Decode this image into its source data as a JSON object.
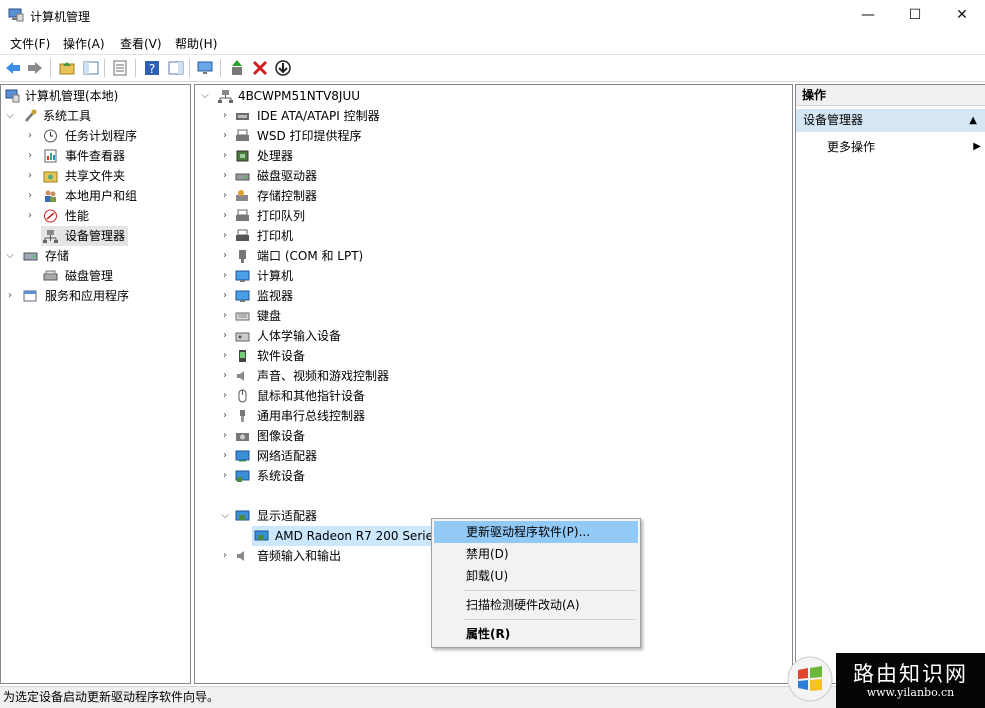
{
  "window": {
    "title": "计算机管理",
    "minimize": "—",
    "maximize": "☐",
    "close": "✕"
  },
  "menubar": [
    "文件(F)",
    "操作(A)",
    "查看(V)",
    "帮助(H)"
  ],
  "left_tree": {
    "root": "计算机管理(本地)",
    "system_tools": "系统工具",
    "task_scheduler": "任务计划程序",
    "event_viewer": "事件查看器",
    "shared_folders": "共享文件夹",
    "local_users": "本地用户和组",
    "performance": "性能",
    "device_manager": "设备管理器",
    "storage": "存储",
    "disk_management": "磁盘管理",
    "services_apps": "服务和应用程序"
  },
  "device_tree": {
    "computer": "4BCWPM51NTV8JUU",
    "categories": [
      "IDE ATA/ATAPI 控制器",
      "WSD 打印提供程序",
      "处理器",
      "磁盘驱动器",
      "存储控制器",
      "打印队列",
      "打印机",
      "端口 (COM 和 LPT)",
      "计算机",
      "监视器",
      "键盘",
      "人体学输入设备",
      "软件设备",
      "声音、视频和游戏控制器",
      "鼠标和其他指针设备",
      "通用串行总线控制器",
      "图像设备",
      "网络适配器",
      "系统设备",
      "显示适配器"
    ],
    "display_child": "AMD Radeon R7 200 Series",
    "audio_io": "音频输入和输出"
  },
  "actions": {
    "header": "操作",
    "section": "设备管理器",
    "more": "更多操作"
  },
  "context_menu": {
    "update_driver": "更新驱动程序软件(P)...",
    "disable": "禁用(D)",
    "uninstall": "卸载(U)",
    "scan": "扫描检测硬件改动(A)",
    "properties": "属性(R)"
  },
  "status": "为选定设备启动更新驱动程序软件向导。",
  "watermark": {
    "name": "路由知识网",
    "url": "www.yilanbo.cn"
  }
}
